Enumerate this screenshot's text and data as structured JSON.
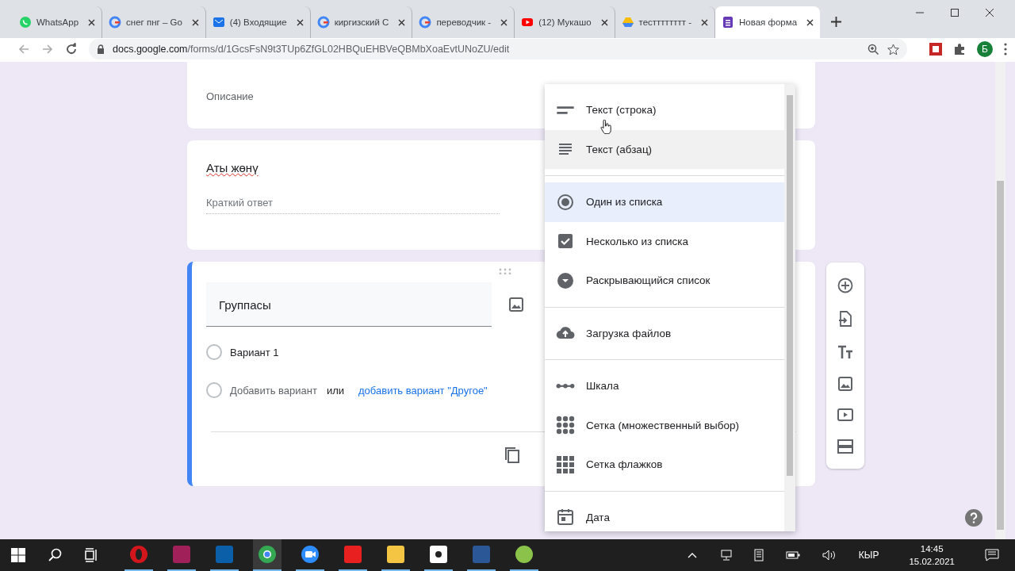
{
  "browser": {
    "tabs": [
      {
        "label": "WhatsApp",
        "kind": "whatsapp",
        "selected": false
      },
      {
        "label": "снег пнг – Go",
        "kind": "google",
        "selected": false
      },
      {
        "label": "(4) Входящие",
        "kind": "mail",
        "selected": false
      },
      {
        "label": "киргизский С",
        "kind": "google",
        "selected": false
      },
      {
        "label": "переводчик -",
        "kind": "google",
        "selected": false
      },
      {
        "label": "(12) Мукашо",
        "kind": "youtube",
        "selected": false
      },
      {
        "label": "тестттттттт -",
        "kind": "drive",
        "selected": false
      },
      {
        "label": "Новая форма",
        "kind": "forms",
        "selected": true
      }
    ],
    "url_host": "docs.google.com",
    "url_path": "/forms/d/1GcsFsN9t3TUp6ZfGL02HBQuEHBVeQBMbXoaEvtUNoZU/edit",
    "profile_initial": "Б"
  },
  "form": {
    "description_placeholder": "Описание",
    "question_1": {
      "title": "Аты жөнү",
      "answer_placeholder": "Краткий ответ"
    },
    "question_2": {
      "title": "Группасы",
      "options": [
        {
          "label": "Вариант 1",
          "selected": false
        }
      ],
      "add_row_selected": false,
      "add_option": "Добавить вариант",
      "or": "или",
      "add_other": "добавить вариант \"Другое\""
    }
  },
  "type_menu": {
    "groups": [
      [
        {
          "label": "Текст (строка)",
          "kind": "short",
          "selected": false,
          "hovered": false
        },
        {
          "label": "Текст (абзац)",
          "kind": "paragraph",
          "selected": false,
          "hovered": true
        }
      ],
      [
        {
          "label": "Один из списка",
          "kind": "radio",
          "selected": true,
          "hovered": false
        },
        {
          "label": "Несколько из списка",
          "kind": "checkbox",
          "selected": false,
          "hovered": false
        },
        {
          "label": "Раскрывающийся список",
          "kind": "dropdown",
          "selected": false,
          "hovered": false
        }
      ],
      [
        {
          "label": "Загрузка файлов",
          "kind": "upload",
          "selected": false,
          "hovered": false
        }
      ],
      [
        {
          "label": "Шкала",
          "kind": "scale",
          "selected": false,
          "hovered": false
        },
        {
          "label": "Сетка (множественный выбор)",
          "kind": "grid",
          "selected": false,
          "hovered": false
        },
        {
          "label": "Сетка флажков",
          "kind": "checkgrid",
          "selected": false,
          "hovered": false
        }
      ],
      [
        {
          "label": "Дата",
          "kind": "date",
          "selected": false,
          "hovered": false
        }
      ]
    ]
  },
  "taskbar": {
    "apps": [
      {
        "kind": "opera",
        "selected": false
      },
      {
        "kind": "indesign",
        "selected": false
      },
      {
        "kind": "photoshop",
        "selected": false
      },
      {
        "kind": "chrome",
        "selected": true
      },
      {
        "kind": "zoom",
        "selected": false
      },
      {
        "kind": "yandex",
        "selected": false
      },
      {
        "kind": "folder",
        "selected": false
      },
      {
        "kind": "settings",
        "selected": false
      },
      {
        "kind": "word",
        "selected": false
      },
      {
        "kind": "corel",
        "selected": false
      }
    ],
    "language": "КЫР",
    "time": "14:45",
    "date": "15.02.2021"
  }
}
